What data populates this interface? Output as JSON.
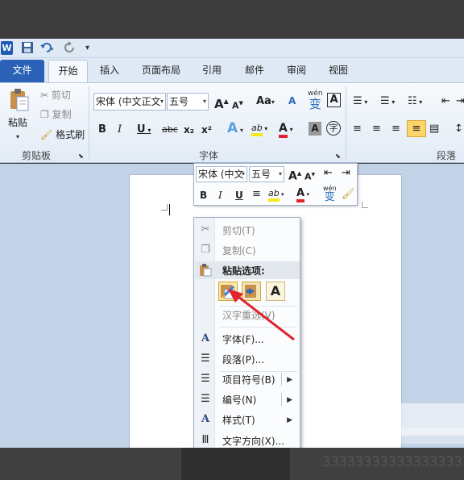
{
  "qat": {
    "logo": "W",
    "more": "▾"
  },
  "tabs": [
    {
      "label": "文件"
    },
    {
      "label": "开始"
    },
    {
      "label": "插入"
    },
    {
      "label": "页面布局"
    },
    {
      "label": "引用"
    },
    {
      "label": "邮件"
    },
    {
      "label": "审阅"
    },
    {
      "label": "视图"
    }
  ],
  "clipboard": {
    "paste": "粘贴",
    "cut": "剪切",
    "copy": "复制",
    "format_painter": "格式刷",
    "group_label": "剪贴板"
  },
  "font": {
    "font_name": "宋体 (中文正文",
    "font_size": "五号",
    "grow": "A",
    "shrink": "A",
    "change_case": "Aa",
    "clear_format": "A",
    "phonetic_top": "wén",
    "phonetic_bottom": "变",
    "char_border": "A",
    "bold": "B",
    "italic": "I",
    "underline": "U",
    "strike": "abc",
    "subscript": "x₂",
    "superscript": "x²",
    "text_effect": "A",
    "highlight": "ab",
    "font_color": "A",
    "char_shading": "A",
    "enclose": "字",
    "group_label": "字体"
  },
  "paragraph": {
    "group_label": "段落"
  },
  "mini_toolbar": {
    "font_name": "宋体 (中文",
    "font_size": "五号",
    "grow": "A",
    "shrink": "A",
    "bold": "B",
    "italic": "I",
    "underline": "U",
    "highlight": "ab",
    "font_color": "A",
    "phonetic_top": "wén",
    "phonetic_bottom": "变"
  },
  "context_menu": {
    "cut": "剪切(T)",
    "copy": "复制(C)",
    "paste_options": "粘贴选项:",
    "keep_text": "A",
    "hanzi": "汉字重选(V)",
    "font": "字体(F)...",
    "paragraph": "段落(P)...",
    "bullets": "项目符号(B)",
    "numbering": "编号(N)",
    "styles": "样式(T)",
    "text_direction": "文字方向(X)..."
  },
  "watermark": "3333333333333333333",
  "colors": {
    "file_tab": "#2b62b8",
    "ribbon_bg": "#e2ebf6",
    "doc_bg": "#c3d3e7",
    "accent_red": "#e0232e",
    "highlight": "#fde9a8"
  }
}
